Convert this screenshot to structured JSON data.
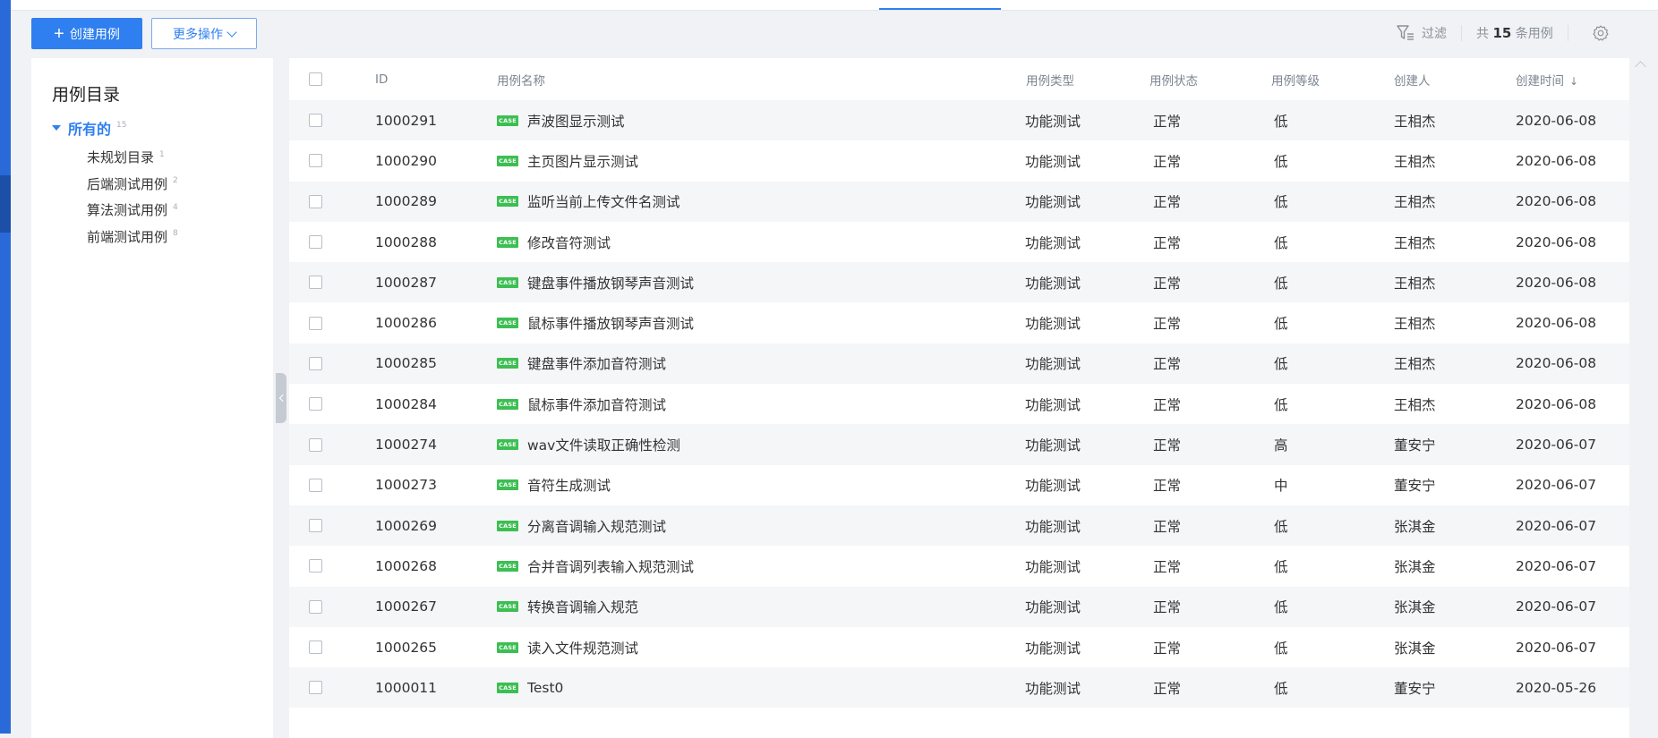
{
  "toolbar": {
    "create_label": "创建用例",
    "more_label": "更多操作",
    "filter_label": "过滤",
    "count_prefix": "共",
    "count_value": "15",
    "count_suffix": "条用例"
  },
  "sidebar": {
    "title": "用例目录",
    "root": {
      "label": "所有的",
      "count": "15"
    },
    "items": [
      {
        "label": "未规划目录",
        "count": "1"
      },
      {
        "label": "后端测试用例",
        "count": "2"
      },
      {
        "label": "算法测试用例",
        "count": "4"
      },
      {
        "label": "前端测试用例",
        "count": "8"
      }
    ]
  },
  "table": {
    "headers": {
      "id": "ID",
      "name": "用例名称",
      "type": "用例类型",
      "status": "用例状态",
      "level": "用例等级",
      "creator": "创建人",
      "time": "创建时间"
    },
    "badge": "CASE",
    "rows": [
      {
        "id": "1000291",
        "name": "声波图显示测试",
        "type": "功能测试",
        "status": "正常",
        "level": "低",
        "creator": "王相杰",
        "time": "2020-06-08"
      },
      {
        "id": "1000290",
        "name": "主页图片显示测试",
        "type": "功能测试",
        "status": "正常",
        "level": "低",
        "creator": "王相杰",
        "time": "2020-06-08"
      },
      {
        "id": "1000289",
        "name": "监听当前上传文件名测试",
        "type": "功能测试",
        "status": "正常",
        "level": "低",
        "creator": "王相杰",
        "time": "2020-06-08"
      },
      {
        "id": "1000288",
        "name": "修改音符测试",
        "type": "功能测试",
        "status": "正常",
        "level": "低",
        "creator": "王相杰",
        "time": "2020-06-08"
      },
      {
        "id": "1000287",
        "name": "键盘事件播放钢琴声音测试",
        "type": "功能测试",
        "status": "正常",
        "level": "低",
        "creator": "王相杰",
        "time": "2020-06-08"
      },
      {
        "id": "1000286",
        "name": "鼠标事件播放钢琴声音测试",
        "type": "功能测试",
        "status": "正常",
        "level": "低",
        "creator": "王相杰",
        "time": "2020-06-08"
      },
      {
        "id": "1000285",
        "name": "键盘事件添加音符测试",
        "type": "功能测试",
        "status": "正常",
        "level": "低",
        "creator": "王相杰",
        "time": "2020-06-08"
      },
      {
        "id": "1000284",
        "name": "鼠标事件添加音符测试",
        "type": "功能测试",
        "status": "正常",
        "level": "低",
        "creator": "王相杰",
        "time": "2020-06-08"
      },
      {
        "id": "1000274",
        "name": "wav文件读取正确性检测",
        "type": "功能测试",
        "status": "正常",
        "level": "高",
        "creator": "董安宁",
        "time": "2020-06-07"
      },
      {
        "id": "1000273",
        "name": "音符生成测试",
        "type": "功能测试",
        "status": "正常",
        "level": "中",
        "creator": "董安宁",
        "time": "2020-06-07"
      },
      {
        "id": "1000269",
        "name": "分离音调输入规范测试",
        "type": "功能测试",
        "status": "正常",
        "level": "低",
        "creator": "张淇金",
        "time": "2020-06-07"
      },
      {
        "id": "1000268",
        "name": "合并音调列表输入规范测试",
        "type": "功能测试",
        "status": "正常",
        "level": "低",
        "creator": "张淇金",
        "time": "2020-06-07"
      },
      {
        "id": "1000267",
        "name": "转换音调输入规范",
        "type": "功能测试",
        "status": "正常",
        "level": "低",
        "creator": "张淇金",
        "time": "2020-06-07"
      },
      {
        "id": "1000265",
        "name": "读入文件规范测试",
        "type": "功能测试",
        "status": "正常",
        "level": "低",
        "creator": "张淇金",
        "time": "2020-06-07"
      },
      {
        "id": "1000011",
        "name": "Test0",
        "type": "功能测试",
        "status": "正常",
        "level": "低",
        "creator": "董安宁",
        "time": "2020-05-26"
      }
    ]
  },
  "colors": {
    "accent": "#2f7ff0",
    "badge": "#3cbf52",
    "row_alt": "#f5f6f8"
  }
}
